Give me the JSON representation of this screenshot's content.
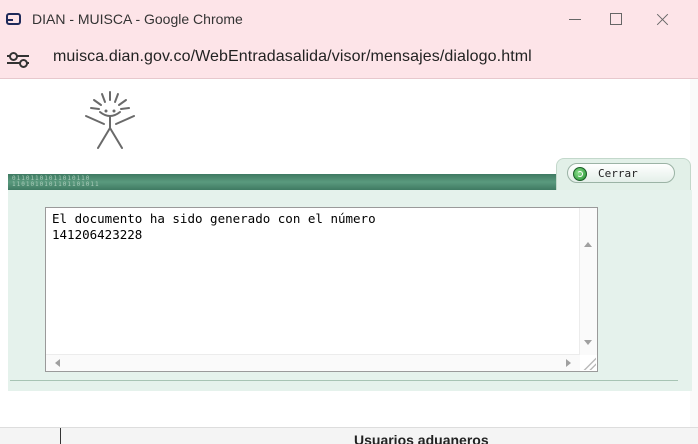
{
  "window": {
    "title": "DIAN - MUISCA - Google Chrome",
    "url": "muisca.dian.gov.co/WebEntradasalida/visor/mensajes/dialogo.html"
  },
  "dialog": {
    "band_pattern_row1": "01101101011010110",
    "band_pattern_row2": "1101010101101101011",
    "close_label": "Cerrar",
    "message": "El documento ha sido generado con el número\n141206423228"
  },
  "background": {
    "partial_text": "Usuarios aduaneros"
  },
  "colors": {
    "titlebar_bg": "#fde4e8",
    "band_green": "#4a8a6e",
    "panel_bg": "#e5f2ec"
  }
}
